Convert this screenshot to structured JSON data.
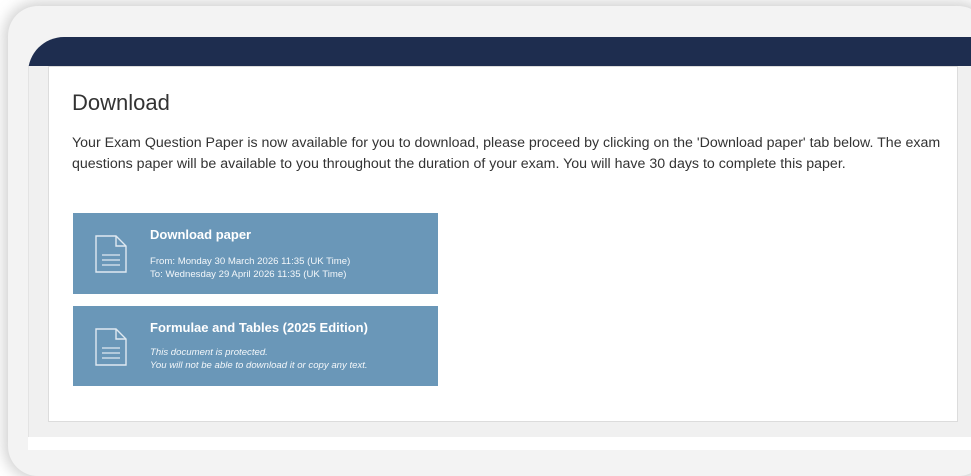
{
  "section": {
    "title": "Download",
    "intro": "Your Exam Question Paper is now available for you to download, please proceed by clicking on the 'Download paper' tab below. The exam questions paper will be available to you throughout the duration of your exam. You will have 30 days to complete this paper."
  },
  "downloads": [
    {
      "title": "Download paper",
      "line1": "From: Monday 30 March 2026 11:35 (UK Time)",
      "line2": "To: Wednesday 29 April 2026 11:35 (UK Time)",
      "icon": "document-icon"
    },
    {
      "title": "Formulae and Tables (2025 Edition)",
      "line1": "This document is protected.",
      "line2": "You will not be able to download it or copy any text.",
      "icon": "document-icon"
    }
  ],
  "colors": {
    "banner": "#1e2d4f",
    "tile": "#6a97b8"
  }
}
